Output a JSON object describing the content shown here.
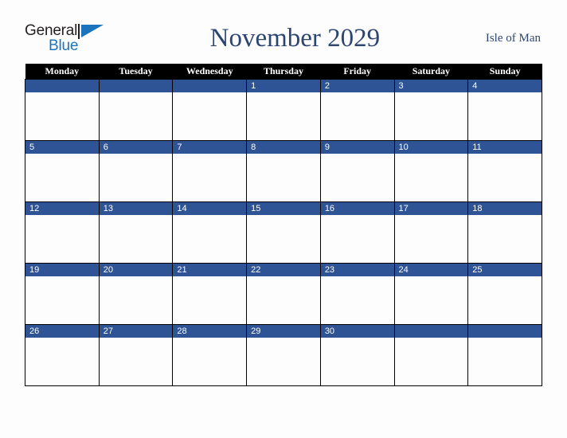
{
  "branding": {
    "logo_text_1": "General",
    "logo_text_2": "Blue",
    "logo_icon": "blue-triangle-mark"
  },
  "header": {
    "title": "November 2029",
    "location": "Isle of Man"
  },
  "colors": {
    "accent_blue": "#2e5496",
    "header_black": "#000000",
    "title_navy": "#2d4671",
    "logo_blue": "#1b75bc",
    "page_background": "#fdfdfd"
  },
  "calendar": {
    "weekday_headers": [
      "Monday",
      "Tuesday",
      "Wednesday",
      "Thursday",
      "Friday",
      "Saturday",
      "Sunday"
    ],
    "weeks": [
      [
        "",
        "",
        "",
        "1",
        "2",
        "3",
        "4"
      ],
      [
        "5",
        "6",
        "7",
        "8",
        "9",
        "10",
        "11"
      ],
      [
        "12",
        "13",
        "14",
        "15",
        "16",
        "17",
        "18"
      ],
      [
        "19",
        "20",
        "21",
        "22",
        "23",
        "24",
        "25"
      ],
      [
        "26",
        "27",
        "28",
        "29",
        "30",
        "",
        ""
      ]
    ]
  }
}
